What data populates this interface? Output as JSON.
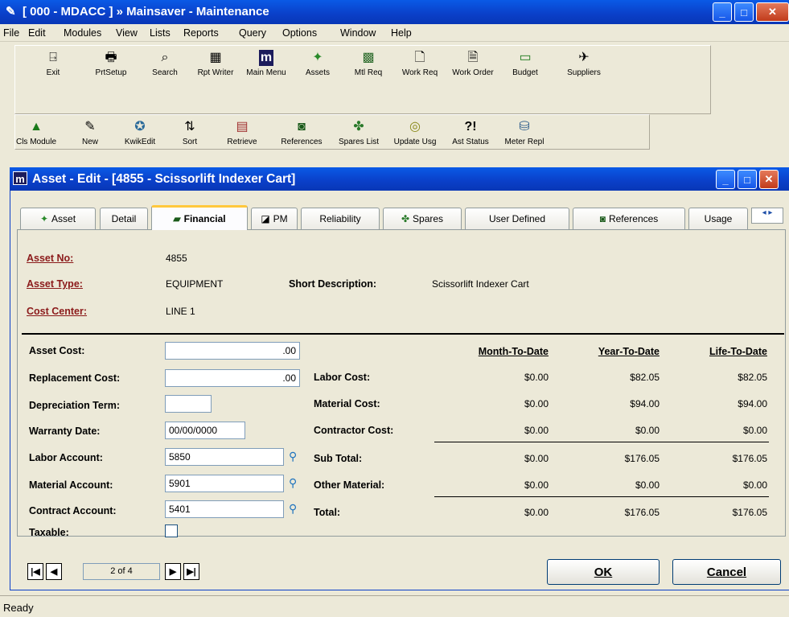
{
  "app": {
    "title": "[ 000 - MDACC ] » Mainsaver - Maintenance",
    "menus": [
      "File",
      "Edit",
      "Modules",
      "View",
      "Lists",
      "Reports",
      "Query",
      "Options",
      "Window",
      "Help"
    ]
  },
  "toolbar1": [
    {
      "label": "Exit",
      "icon": "exit-icon",
      "glyph": "⍈"
    },
    {
      "label": "PrtSetup",
      "icon": "printer-icon",
      "glyph": "🖶"
    },
    {
      "label": "Search",
      "icon": "binoculars-icon",
      "glyph": "⌕"
    },
    {
      "label": "Rpt Writer",
      "icon": "report-icon",
      "glyph": "▦"
    },
    {
      "label": "Main Menu",
      "icon": "main-menu-icon",
      "glyph": "m"
    },
    {
      "label": "Assets",
      "icon": "assets-icon",
      "glyph": "✦"
    },
    {
      "label": "Mtl Req",
      "icon": "material-request-icon",
      "glyph": "▩"
    },
    {
      "label": "Work Req",
      "icon": "work-request-icon",
      "glyph": "🗋"
    },
    {
      "label": "Work Order",
      "icon": "work-order-icon",
      "glyph": "🗎"
    },
    {
      "label": "Budget",
      "icon": "budget-icon",
      "glyph": "▭"
    },
    {
      "label": "Suppliers",
      "icon": "suppliers-icon",
      "glyph": "✈"
    }
  ],
  "toolbar2": [
    {
      "label": "Cls Module",
      "icon": "close-module-icon",
      "glyph": "▲"
    },
    {
      "label": "New",
      "icon": "new-icon",
      "glyph": "✎"
    },
    {
      "label": "KwikEdit",
      "icon": "kwikedit-icon",
      "glyph": "✪"
    },
    {
      "label": "Sort",
      "icon": "sort-icon",
      "glyph": "⇅"
    },
    {
      "label": "Retrieve",
      "icon": "retrieve-icon",
      "glyph": "▤"
    },
    {
      "label": "References",
      "icon": "references-icon",
      "glyph": "◙"
    },
    {
      "label": "Spares List",
      "icon": "spares-list-icon",
      "glyph": "✤"
    },
    {
      "label": "Update Usg",
      "icon": "update-usage-icon",
      "glyph": "◎"
    },
    {
      "label": "Ast Status",
      "icon": "asset-status-icon",
      "glyph": "?!"
    },
    {
      "label": "Meter Repl",
      "icon": "meter-replace-icon",
      "glyph": "⛁"
    }
  ],
  "child": {
    "title": "Asset - Edit - [4855 - Scissorlift Indexer Cart]",
    "logo": "m"
  },
  "tabs": [
    {
      "label": "Asset",
      "icon": "asset-tab-icon",
      "glyph": "✦"
    },
    {
      "label": "Detail",
      "icon": "",
      "glyph": ""
    },
    {
      "label": "Financial",
      "icon": "financial-tab-icon",
      "glyph": "▰"
    },
    {
      "label": "PM",
      "icon": "pm-tab-icon",
      "glyph": "◪"
    },
    {
      "label": "Reliability",
      "icon": "",
      "glyph": ""
    },
    {
      "label": "Spares",
      "icon": "spares-tab-icon",
      "glyph": "✤"
    },
    {
      "label": "User Defined",
      "icon": "",
      "glyph": ""
    },
    {
      "label": "References",
      "icon": "references-tab-icon",
      "glyph": "◙"
    },
    {
      "label": "Usage",
      "icon": "",
      "glyph": ""
    }
  ],
  "header": {
    "asset_no_label": "Asset No:",
    "asset_no": "4855",
    "asset_type_label": "Asset Type:",
    "asset_type": "EQUIPMENT",
    "short_desc_label": "Short Description:",
    "short_desc": "Scissorlift Indexer Cart",
    "cost_center_label": "Cost Center:",
    "cost_center": "LINE 1"
  },
  "fields": {
    "asset_cost_label": "Asset Cost:",
    "asset_cost": ".00",
    "replacement_cost_label": "Replacement Cost:",
    "replacement_cost": ".00",
    "depreciation_term_label": "Depreciation Term:",
    "depreciation_term": "",
    "warranty_date_label": "Warranty Date:",
    "warranty_date": "00/00/0000",
    "labor_account_label": "Labor Account:",
    "labor_account": "5850",
    "material_account_label": "Material Account:",
    "material_account": "5901",
    "contract_account_label": "Contract Account:",
    "contract_account": "5401",
    "taxable_label": "Taxable:"
  },
  "costs": {
    "columns": [
      "Month-To-Date",
      "Year-To-Date",
      "Life-To-Date"
    ],
    "rows": [
      {
        "label": "Labor Cost:",
        "values": [
          "$0.00",
          "$82.05",
          "$82.05"
        ]
      },
      {
        "label": "Material Cost:",
        "values": [
          "$0.00",
          "$94.00",
          "$94.00"
        ]
      },
      {
        "label": "Contractor Cost:",
        "values": [
          "$0.00",
          "$0.00",
          "$0.00"
        ]
      },
      {
        "label": "Sub Total:",
        "values": [
          "$0.00",
          "$176.05",
          "$176.05"
        ]
      },
      {
        "label": "Other Material:",
        "values": [
          "$0.00",
          "$0.00",
          "$0.00"
        ]
      },
      {
        "label": "Total:",
        "values": [
          "$0.00",
          "$176.05",
          "$176.05"
        ]
      }
    ]
  },
  "nav": {
    "record": "2 of 4"
  },
  "buttons": {
    "ok": "OK",
    "cancel": "Cancel"
  },
  "status": "Ready"
}
